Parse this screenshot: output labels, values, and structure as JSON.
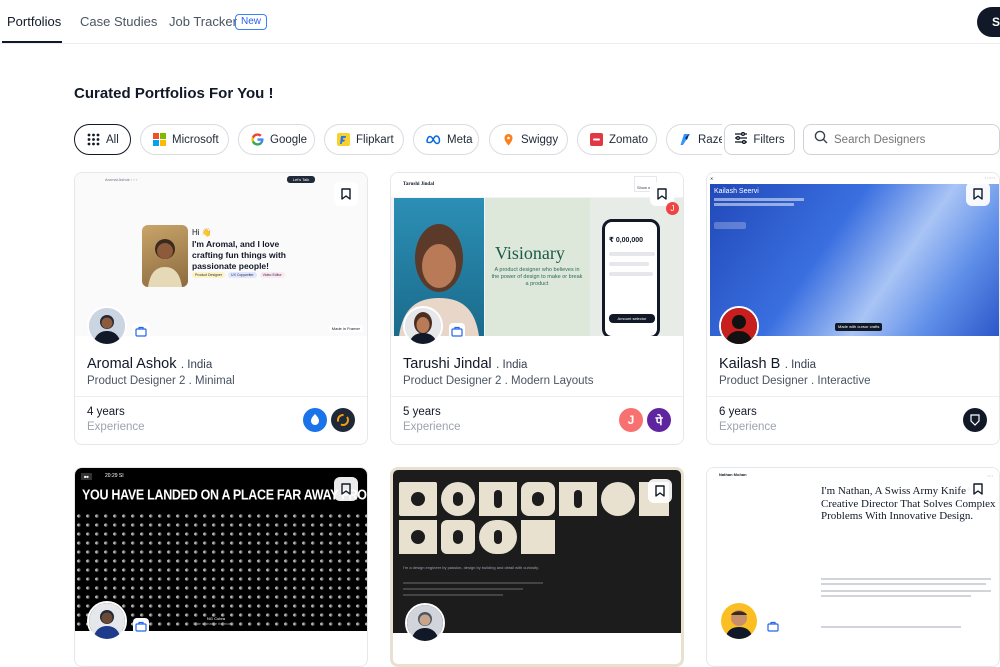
{
  "nav": {
    "tabs": [
      {
        "label": "Portfolios",
        "active": true
      },
      {
        "label": "Case Studies",
        "active": false
      },
      {
        "label": "Job Tracker",
        "active": false
      }
    ],
    "new_badge": "New",
    "right_button": "S"
  },
  "heading": "Curated Portfolios For You !",
  "companies": [
    {
      "label": "All",
      "icon": "grid-icon",
      "active": true
    },
    {
      "label": "Microsoft",
      "icon": "microsoft-logo"
    },
    {
      "label": "Google",
      "icon": "google-logo"
    },
    {
      "label": "Flipkart",
      "icon": "flipkart-logo"
    },
    {
      "label": "Meta",
      "icon": "meta-logo"
    },
    {
      "label": "Swiggy",
      "icon": "swiggy-logo"
    },
    {
      "label": "Zomato",
      "icon": "zomato-logo"
    },
    {
      "label": "Raze",
      "icon": "razorpay-logo"
    }
  ],
  "filters_label": "Filters",
  "search": {
    "placeholder": "Search Designers"
  },
  "cards": [
    {
      "name": "Aromal Ashok",
      "country": ". India",
      "role": "Product Designer 2 . Minimal",
      "years": "4 years",
      "experience_label": "Experience",
      "thumb": {
        "hello": "Hi 👋",
        "headline": "I'm Aromal, and I love crafting fun things with passionate people!",
        "chips": [
          "Product Designer",
          "UX Copywriter",
          "Video Editor"
        ],
        "nav_button": "Let's Talk",
        "footer": "Made in Framer"
      }
    },
    {
      "name": "Tarushi Jindal",
      "country": ". India",
      "role": "Product Designer 2 . Modern Layouts",
      "years": "5 years",
      "experience_label": "Experience",
      "thumb": {
        "site_name": "Tarushi Jindal",
        "title": "Visionary",
        "subtitle": "A product designer who believes in the power of design to make or break a product",
        "phone_amount": "₹ 0,00,000",
        "phone_button": "Amount selector",
        "tag": "Show me"
      }
    },
    {
      "name": "Kailash B",
      "country": ". India",
      "role": "Product Designer . Interactive",
      "years": "6 years",
      "experience_label": "Experience",
      "thumb": {
        "site_name": "Kailash Seervi",
        "button": "Made with cursor crafts"
      }
    },
    {
      "thumb": {
        "time": "20:29 SI",
        "headline": "YOU HAVE LANDED ON A PLACE FAR AWAY FROM HOME",
        "player": "NG Cobra",
        "caption": "Slide to change the music"
      }
    },
    {
      "thumb": {
        "caption": "I'm a design engineer by passion, design by building and detail with curiosity."
      }
    },
    {
      "thumb": {
        "logo": "Nathan Mohan",
        "headline": "I'm Nathan, A Swiss Army Knife* Creative Director That Solves Complex Problems With Innovative Design."
      }
    }
  ],
  "colors": {
    "primary_dark": "#111827",
    "accent_blue": "#2563eb",
    "border": "#e5e7eb"
  }
}
